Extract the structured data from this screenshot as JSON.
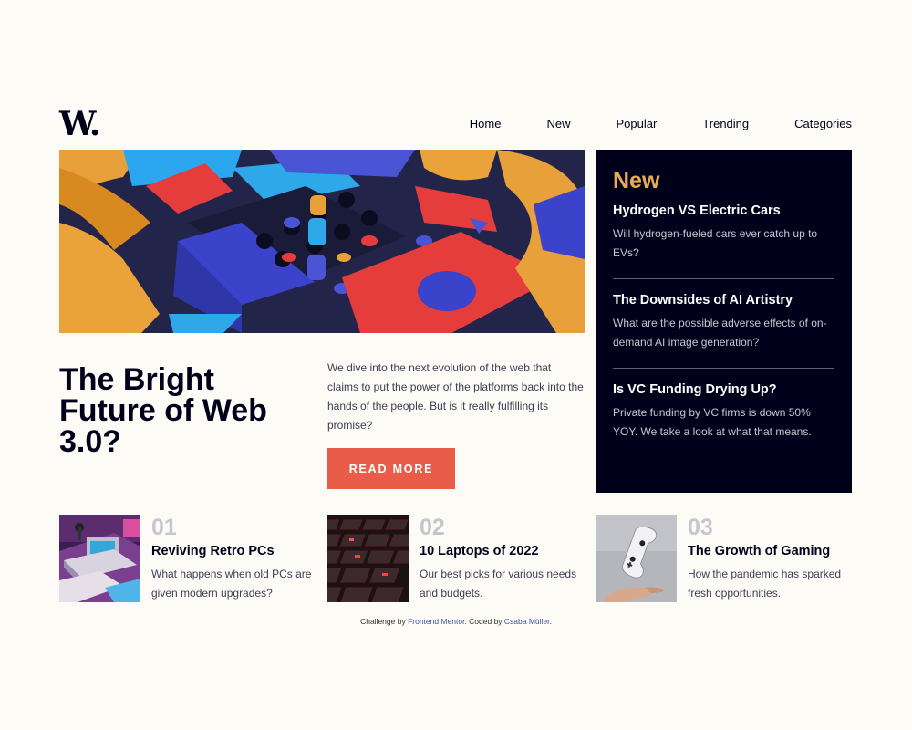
{
  "brand": {
    "logo_text": "W."
  },
  "nav": {
    "items": [
      "Home",
      "New",
      "Popular",
      "Trending",
      "Categories"
    ]
  },
  "hero": {
    "image_icon": "web3-blocks-illustration",
    "title": "The Bright Future of Web 3.0?",
    "body": "We dive into the next evolution of the web that claims to put the power of the platforms back into the hands of the people. But is it really fulfilling its promise?",
    "cta_label": "READ MORE"
  },
  "new_panel": {
    "heading": "New",
    "items": [
      {
        "title": "Hydrogen VS Electric Cars",
        "desc": "Will hydrogen-fueled cars ever catch up to EVs?"
      },
      {
        "title": "The Downsides of AI Artistry",
        "desc": "What are the possible adverse effects of on-demand AI image generation?"
      },
      {
        "title": "Is VC Funding Drying Up?",
        "desc": "Private funding by VC firms is down 50% YOY. We take a look at what that means."
      }
    ]
  },
  "features": [
    {
      "num": "01",
      "title": "Reviving Retro PCs",
      "desc": "What happens when old PCs are given modern upgrades?",
      "image_icon": "retro-pc-image"
    },
    {
      "num": "02",
      "title": "10 Laptops of 2022",
      "desc": "Our best picks for various needs and budgets.",
      "image_icon": "keyboard-image"
    },
    {
      "num": "03",
      "title": "The Growth of Gaming",
      "desc": "How the pandemic has sparked fresh opportunities.",
      "image_icon": "game-controller-image"
    }
  ],
  "attribution": {
    "prefix": "Challenge by ",
    "challenge_link": "Frontend Mentor",
    "middle": ". Coded by ",
    "author_link": "Csaba Müller",
    "suffix": "."
  },
  "colors": {
    "background": "#fdfbf6",
    "dark_navy": "#00001a",
    "accent_red": "#e95c4a",
    "accent_orange": "#e9ab53",
    "grayish_blue": "#c5c6ce"
  }
}
